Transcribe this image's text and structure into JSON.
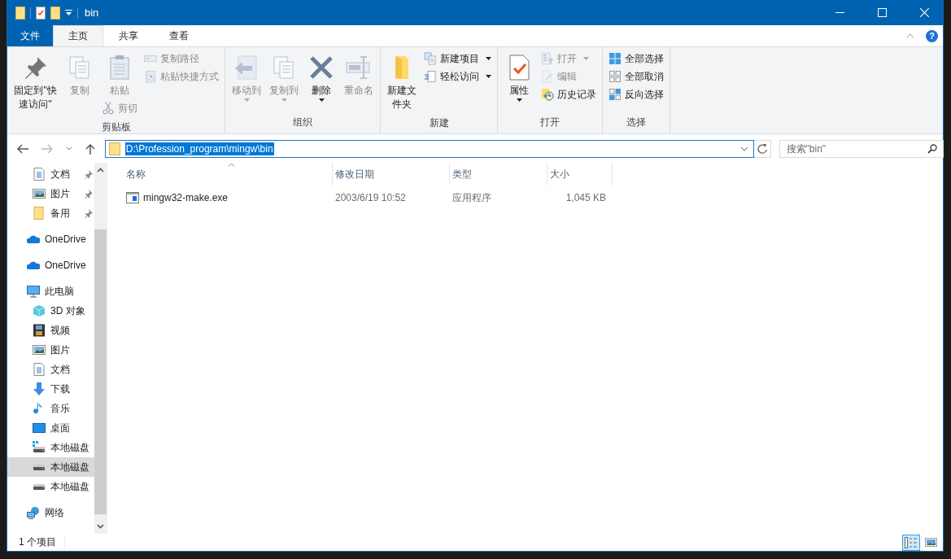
{
  "window": {
    "title": "bin"
  },
  "help_button": {
    "label": "?"
  },
  "ribbon_tabs": [
    {
      "label": "文件",
      "kind": "file",
      "selected": false
    },
    {
      "label": "主页",
      "kind": "tab",
      "selected": true
    },
    {
      "label": "共享",
      "kind": "tab",
      "selected": false
    },
    {
      "label": "查看",
      "kind": "tab",
      "selected": false
    }
  ],
  "ribbon_groups": [
    {
      "label": "剪贴板",
      "columns": [
        [
          {
            "label": "固定到\"快速访问\"",
            "kind": "large",
            "disabled": false,
            "dropdown": false
          }
        ],
        [
          {
            "label": "复制",
            "kind": "large",
            "disabled": true,
            "dropdown": false
          }
        ],
        [
          {
            "label": "粘贴",
            "kind": "large",
            "disabled": true,
            "dropdown": false
          },
          {
            "label": "剪切",
            "kind": "small",
            "disabled": true,
            "dropdown": false
          }
        ],
        [
          {
            "label": "复制路径",
            "kind": "small",
            "disabled": true,
            "dropdown": false
          },
          {
            "label": "粘贴快捷方式",
            "kind": "small",
            "disabled": true,
            "dropdown": false
          }
        ]
      ]
    },
    {
      "label": "组织",
      "columns": [
        [
          {
            "label": "移动到",
            "kind": "large",
            "disabled": true,
            "dropdown": true
          }
        ],
        [
          {
            "label": "复制到",
            "kind": "large",
            "disabled": true,
            "dropdown": true
          }
        ],
        [
          {
            "label": "删除",
            "kind": "large",
            "disabled": false,
            "dropdown": true
          }
        ],
        [
          {
            "label": "重命名",
            "kind": "large",
            "disabled": true,
            "dropdown": false
          }
        ]
      ]
    },
    {
      "label": "新建",
      "columns": [
        [
          {
            "label": "新建文件夹",
            "kind": "large",
            "disabled": false,
            "dropdown": false
          }
        ],
        [
          {
            "label": "新建项目",
            "kind": "small",
            "disabled": false,
            "dropdown": true
          },
          {
            "label": "轻松访问",
            "kind": "small",
            "disabled": false,
            "dropdown": true
          }
        ]
      ]
    },
    {
      "label": "打开",
      "columns": [
        [
          {
            "label": "属性",
            "kind": "large",
            "disabled": false,
            "dropdown": true
          }
        ],
        [
          {
            "label": "打开",
            "kind": "small",
            "disabled": true,
            "dropdown": true
          },
          {
            "label": "编辑",
            "kind": "small",
            "disabled": true,
            "dropdown": false
          },
          {
            "label": "历史记录",
            "kind": "small",
            "disabled": false,
            "dropdown": false
          }
        ]
      ]
    },
    {
      "label": "选择",
      "columns": [
        [
          {
            "label": "全部选择",
            "kind": "small",
            "disabled": false,
            "dropdown": false
          },
          {
            "label": "全部取消",
            "kind": "small",
            "disabled": false,
            "dropdown": false
          },
          {
            "label": "反向选择",
            "kind": "small",
            "disabled": false,
            "dropdown": false
          }
        ]
      ]
    }
  ],
  "address": {
    "value": "D:\\Profession_program\\mingw\\bin",
    "selected": true
  },
  "search": {
    "placeholder": "搜索\"bin\""
  },
  "sidebar": {
    "items": [
      {
        "label": "文档",
        "pinned": true,
        "selected": false
      },
      {
        "label": "图片",
        "pinned": true,
        "selected": false
      },
      {
        "label": "备用",
        "pinned": true,
        "selected": false
      },
      {
        "label": "OneDrive",
        "pinned": false,
        "selected": false
      },
      {
        "label": "OneDrive",
        "pinned": false,
        "selected": false
      },
      {
        "label": "此电脑",
        "pinned": false,
        "selected": false,
        "children": [
          {
            "label": "3D 对象",
            "selected": false
          },
          {
            "label": "视频",
            "selected": false
          },
          {
            "label": "图片",
            "selected": false
          },
          {
            "label": "文档",
            "selected": false
          },
          {
            "label": "下载",
            "selected": false
          },
          {
            "label": "音乐",
            "selected": false
          },
          {
            "label": "桌面",
            "selected": false
          },
          {
            "label": "本地磁盘",
            "selected": false
          },
          {
            "label": "本地磁盘",
            "selected": true
          },
          {
            "label": "本地磁盘",
            "selected": false
          }
        ]
      },
      {
        "label": "网络",
        "pinned": false,
        "selected": false
      }
    ]
  },
  "table": {
    "columns": [
      {
        "label": "名称",
        "sorted": true
      },
      {
        "label": "修改日期",
        "sorted": false
      },
      {
        "label": "类型",
        "sorted": false
      },
      {
        "label": "大小",
        "sorted": false
      }
    ],
    "rows": [
      {
        "name": "mingw32-make.exe",
        "modified": "2003/6/19 10:52",
        "type": "应用程序",
        "size": "1,045 KB"
      }
    ]
  },
  "status_bar": {
    "count": "1 个项目",
    "views": [
      {
        "kind": "details",
        "selected": true
      },
      {
        "kind": "large-icons",
        "selected": false
      }
    ]
  }
}
